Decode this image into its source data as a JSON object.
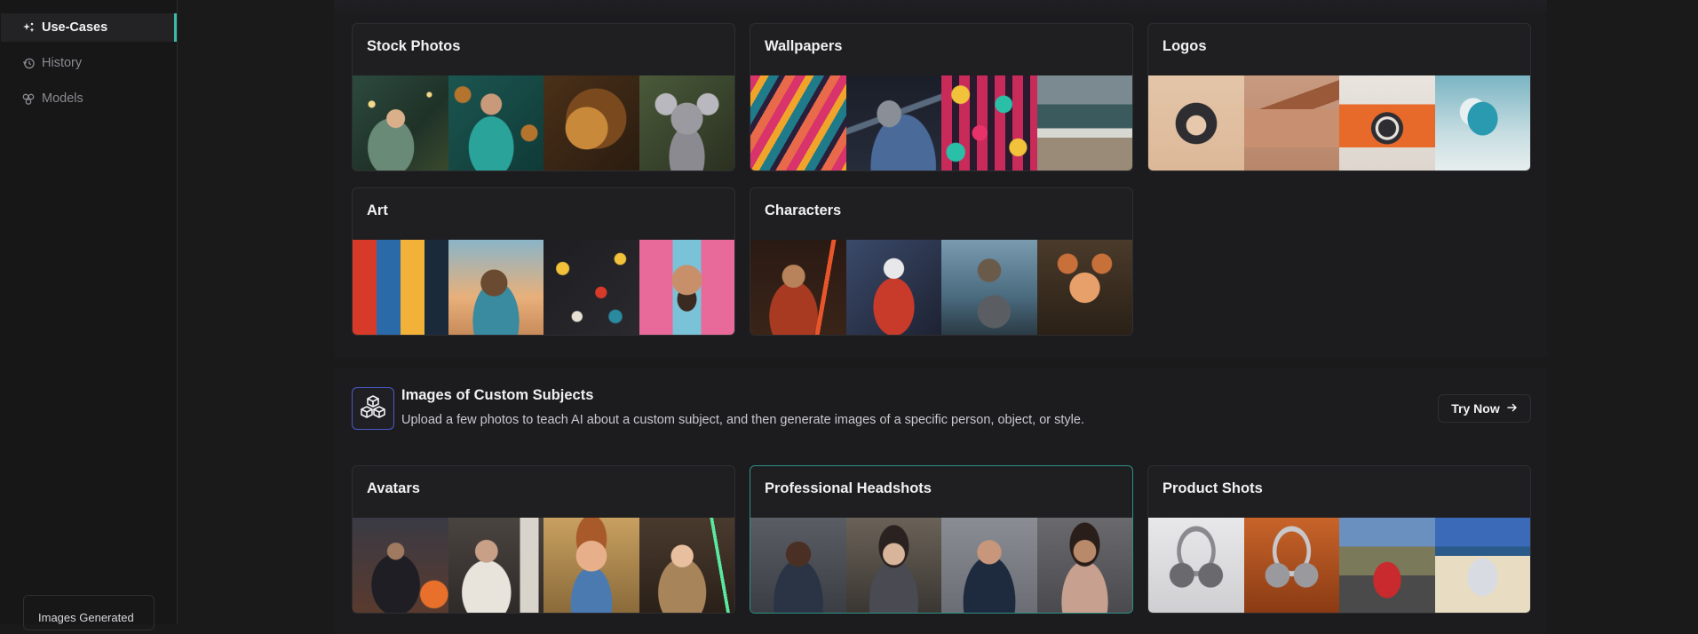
{
  "sidebar": {
    "items": [
      {
        "label": "Use-Cases",
        "icon": "sparkles-icon",
        "active": true
      },
      {
        "label": "History",
        "icon": "history-icon",
        "active": false
      },
      {
        "label": "Models",
        "icon": "models-icon",
        "active": false
      }
    ],
    "images_generated_label": "Images Generated"
  },
  "use_cases": {
    "cards": [
      {
        "title": "Stock Photos",
        "thumbs": [
          "fairy woman portrait",
          "woman in teal dress",
          "roaring lion",
          "koala plush"
        ]
      },
      {
        "title": "Wallpapers",
        "thumbs": [
          "abstract color swirls",
          "spaceship in orbit",
          "geometric shapes pattern",
          "ocean waves"
        ]
      },
      {
        "title": "Logos",
        "thumbs": [
          "fox mascot logo",
          "wooden house logo",
          "camera logo",
          "cloud logo"
        ]
      },
      {
        "title": "Art",
        "thumbs": [
          "cubist face painting",
          "surreal woman sculpture",
          "paint splatter abstract",
          "pop art bearded man"
        ]
      },
      {
        "title": "Characters",
        "thumbs": [
          "woman with lightsaber",
          "ninja warrior",
          "viking warrior with shield",
          "cartoon squirrel"
        ]
      }
    ]
  },
  "custom_subjects": {
    "title": "Images of Custom Subjects",
    "description": "Upload a few photos to teach AI about a custom subject, and then generate images of a specific person, object, or style.",
    "icon": "cubes-icon",
    "try_now_label": "Try Now",
    "cards": [
      {
        "title": "Avatars",
        "thumbs": [
          "hooded warrior",
          "woman by column",
          "cartoon boy",
          "girl with lightsaber"
        ]
      },
      {
        "title": "Professional Headshots",
        "thumbs": [
          "man in suit",
          "woman in blazer",
          "man arms crossed",
          "woman in dress"
        ]
      },
      {
        "title": "Product Shots",
        "thumbs": [
          "headphones on white",
          "headphones on orange",
          "red suv on road",
          "white suv on beach"
        ]
      }
    ]
  },
  "colors": {
    "accent": "#3fb8a8",
    "highlight_border": "#2f8f86",
    "icon_border": "#4a5cc9"
  }
}
